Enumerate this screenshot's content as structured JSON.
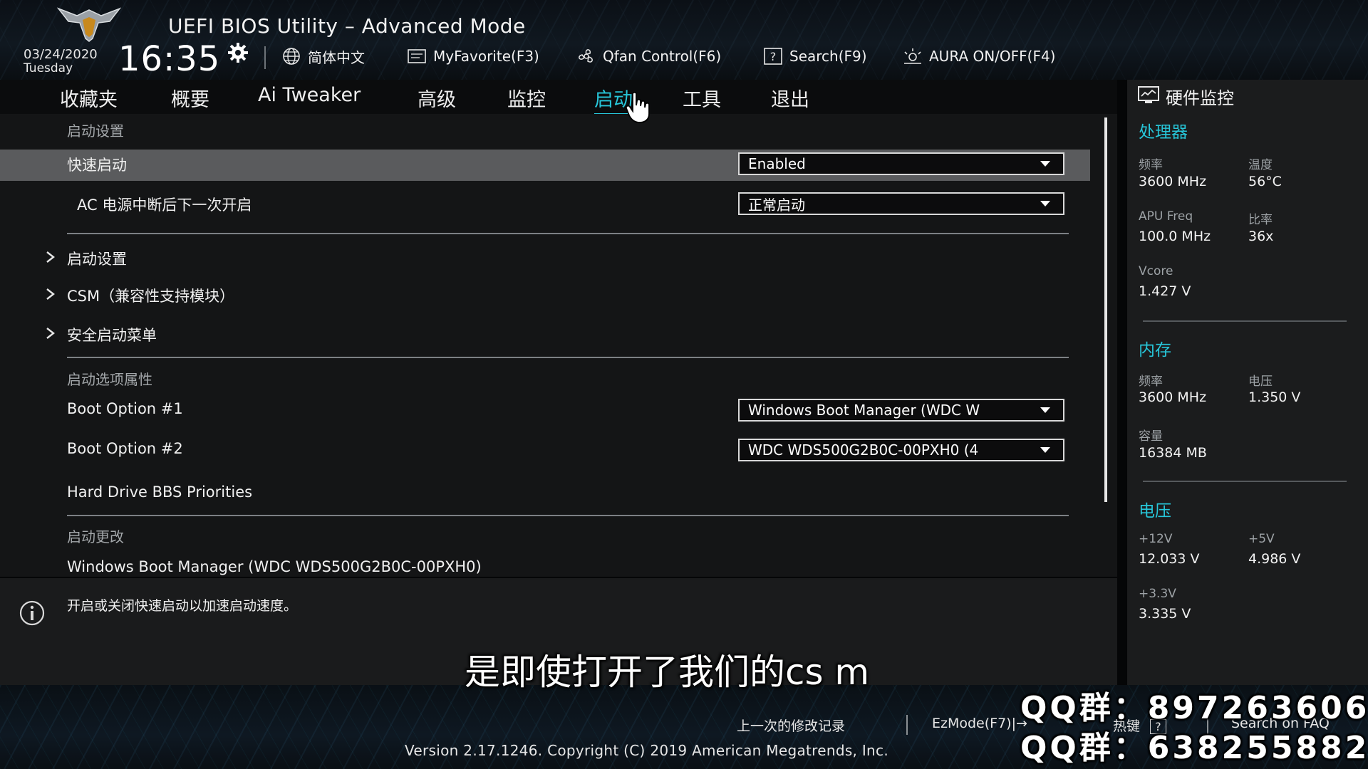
{
  "header": {
    "title": "UEFI BIOS Utility – Advanced Mode",
    "date": "03/24/2020",
    "weekday": "Tuesday",
    "time": "16:35",
    "buttons": [
      {
        "label": "简体中文",
        "icon": "globe-icon"
      },
      {
        "label": "MyFavorite(F3)",
        "icon": "favorite-icon"
      },
      {
        "label": "Qfan Control(F6)",
        "icon": "fan-icon"
      },
      {
        "label": "Search(F9)",
        "icon": "search-help-icon"
      },
      {
        "label": "AURA ON/OFF(F4)",
        "icon": "aura-icon"
      }
    ]
  },
  "tabs": [
    {
      "label": "收藏夹"
    },
    {
      "label": "概要"
    },
    {
      "label": "Ai Tweaker"
    },
    {
      "label": "高级"
    },
    {
      "label": "监控"
    },
    {
      "label": "启动",
      "active": true
    },
    {
      "label": "工具"
    },
    {
      "label": "退出"
    }
  ],
  "main": {
    "section_boot_config": "启动设置",
    "fast_boot": {
      "label": "快速启动",
      "value": "Enabled"
    },
    "ac_power": {
      "label": "AC 电源中断后下一次开启",
      "value": "正常启动"
    },
    "submenus": [
      "启动设置",
      "CSM（兼容性支持模块）",
      "安全启动菜单"
    ],
    "section_boot_option": "启动选项属性",
    "boot_option_1": {
      "label": "Boot Option #1",
      "value": "Windows Boot Manager (WDC W"
    },
    "boot_option_2": {
      "label": "Boot Option #2",
      "value": "WDC WDS500G2B0C-00PXH0  (4"
    },
    "hdd_bbs": "Hard Drive BBS Priorities",
    "section_boot_override": "启动更改",
    "override_item": "Windows Boot Manager (WDC WDS500G2B0C-00PXH0)"
  },
  "help": {
    "text": "开启或关闭快速启动以加速启动速度。"
  },
  "monitor": {
    "title": "硬件监控",
    "cpu": {
      "title": "处理器",
      "freq_label": "频率",
      "freq": "3600 MHz",
      "temp_label": "温度",
      "temp": "56°C",
      "apu_label": "APU Freq",
      "apu": "100.0 MHz",
      "ratio_label": "比率",
      "ratio": "36x",
      "vcore_label": "Vcore",
      "vcore": "1.427 V"
    },
    "memory": {
      "title": "内存",
      "freq_label": "频率",
      "freq": "3600 MHz",
      "volt_label": "电压",
      "volt": "1.350 V",
      "cap_label": "容量",
      "cap": "16384 MB"
    },
    "voltage": {
      "title": "电压",
      "v12_label": "+12V",
      "v12": "12.033 V",
      "v5_label": "+5V",
      "v5": "4.986 V",
      "v33_label": "+3.3V",
      "v33": "3.335 V"
    }
  },
  "footer": {
    "last_modified": "上一次的修改记录",
    "ezmode": "EzMode(F7)|→",
    "hotkeys": "热键",
    "hotkeys_badge": "?",
    "faq": "Search on FAQ",
    "version": "Version 2.17.1246. Copyright (C) 2019 American Megatrends, Inc."
  },
  "overlay": {
    "subtitle": "是即使打开了我们的cs m",
    "qq1": "QQ群：897263606",
    "qq2": "QQ群：638255882"
  },
  "colors": {
    "accent": "#27c6d9",
    "highlight_row": "#5a5b5d",
    "panel": "#141516"
  }
}
